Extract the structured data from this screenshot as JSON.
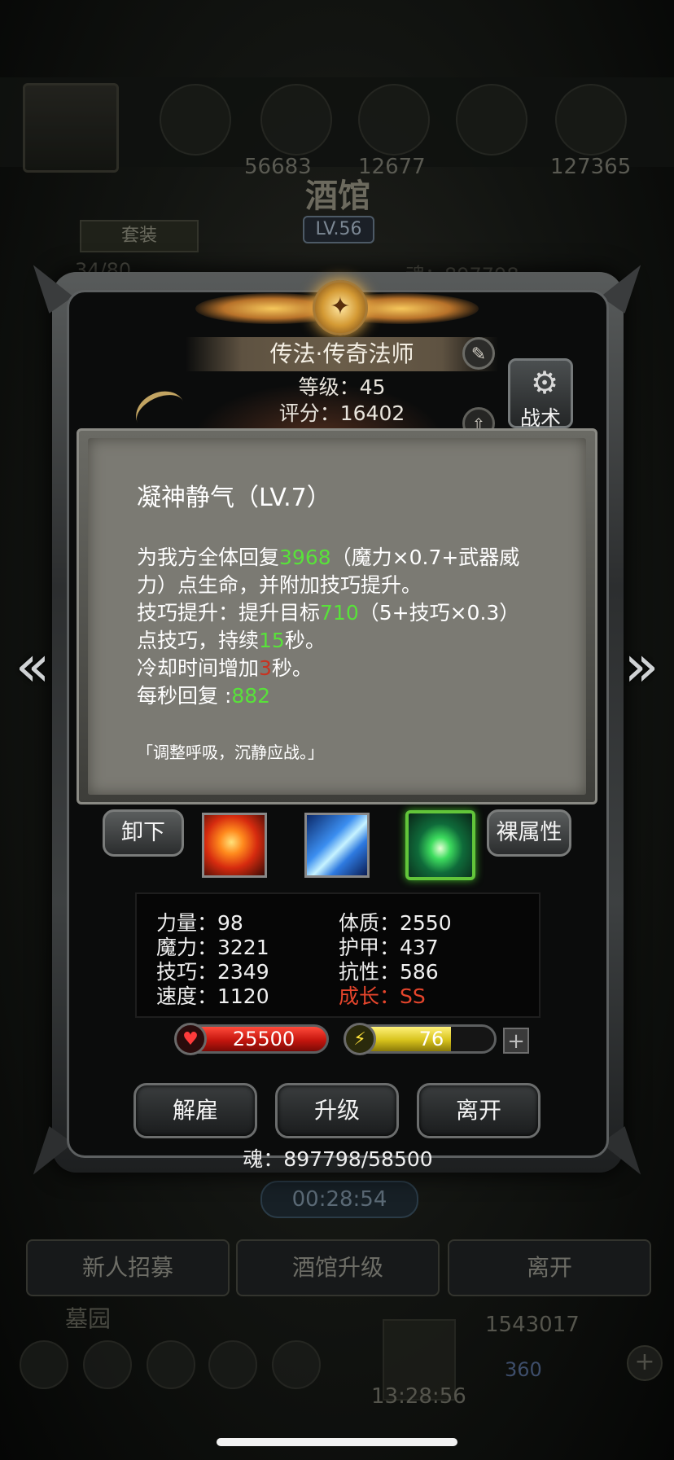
{
  "background": {
    "title": "酒馆",
    "level_badge": "LV.56",
    "suit_label": "套装",
    "hero_count": "34/80",
    "soul_total": "魂：897798",
    "res_numbers": [
      "56683",
      "12677",
      "127365"
    ],
    "timer": "00:28:54",
    "bottom_buttons": [
      "新人招募",
      "酒馆升级",
      "离开"
    ],
    "graveyard_label": "墓园",
    "chest_timer": "13:28:56",
    "gold": "1543017",
    "gem": "360"
  },
  "hero": {
    "name": "传法·传奇法师",
    "level": "等级：45",
    "score": "评分：16402",
    "tactic_label": "战术"
  },
  "skill": {
    "title": "凝神静气（LV.7）",
    "line1_pre": "为我方全体回复",
    "line1_val": "3968",
    "line1_post": "（魔力×0.7+武器威",
    "line2": "力）点生命，并附加技巧提升。",
    "line3_pre": "技巧提升：提升目标",
    "line3_val": "710",
    "line3_post": "（5+技巧×0.3）",
    "line4_pre": "点技巧，持续",
    "line4_val": "15",
    "line4_post": "秒。",
    "line5_pre": "冷却时间增加",
    "line5_val": "3",
    "line5_post": "秒。",
    "line6_pre": "每秒回复 :",
    "line6_val": "882",
    "quote": "「调整呼吸，沉静应战。」"
  },
  "slots": {
    "unequip_label": "卸下",
    "bare_attr_label": "裸属性",
    "icons": [
      "fire-skill-icon",
      "ice-skill-icon",
      "heal-skill-icon"
    ]
  },
  "stats": {
    "strength": "力量：98",
    "magic": "魔力：3221",
    "skill": "技巧：2349",
    "speed": "速度：1120",
    "constitution": "体质：2550",
    "armor": "护甲：437",
    "resistance": "抗性：586",
    "growth": "成长：SS"
  },
  "bars": {
    "hp": "25500",
    "energy": "76",
    "energy_fill_fraction": 0.7
  },
  "actions": {
    "dismiss": "解雇",
    "upgrade": "升级",
    "leave": "离开",
    "soul": "魂：897798/58500"
  },
  "colors": {
    "highlight_green": "#58e23a",
    "highlight_red": "#c83321",
    "growth_red": "#e5452c"
  }
}
